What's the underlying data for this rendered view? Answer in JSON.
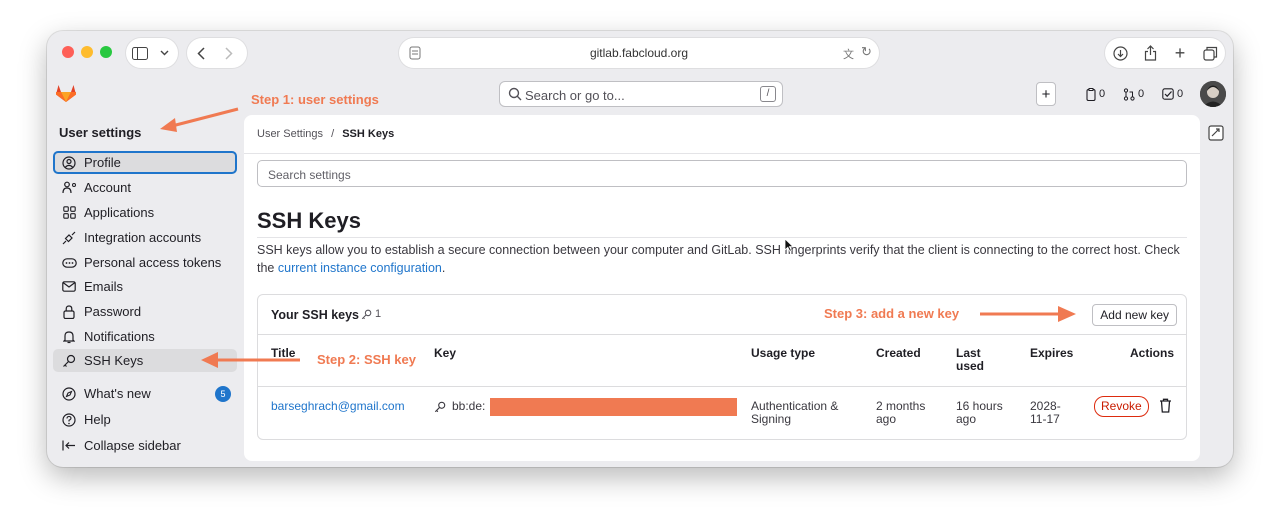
{
  "browser": {
    "url": "gitlab.fabcloud.org"
  },
  "topbar": {
    "search_placeholder": "Search or go to...",
    "search_shortcut": "/",
    "issues_count": "0",
    "mr_count": "0",
    "todo_count": "0"
  },
  "sidebar": {
    "title": "User settings",
    "items": [
      {
        "label": "Profile",
        "icon": "profile-icon"
      },
      {
        "label": "Account",
        "icon": "account-icon"
      },
      {
        "label": "Applications",
        "icon": "applications-icon"
      },
      {
        "label": "Integration accounts",
        "icon": "integration-icon"
      },
      {
        "label": "Personal access tokens",
        "icon": "token-icon"
      },
      {
        "label": "Emails",
        "icon": "mail-icon"
      },
      {
        "label": "Password",
        "icon": "lock-icon"
      },
      {
        "label": "Notifications",
        "icon": "bell-icon"
      },
      {
        "label": "SSH Keys",
        "icon": "key-icon"
      }
    ],
    "bottom": [
      {
        "label": "What's new",
        "icon": "compass-icon",
        "badge": "5"
      },
      {
        "label": "Help",
        "icon": "help-icon"
      },
      {
        "label": "Collapse sidebar",
        "icon": "collapse-icon"
      }
    ]
  },
  "breadcrumb": {
    "parent": "User Settings",
    "separator": "/",
    "current": "SSH Keys"
  },
  "main": {
    "search_placeholder": "Search settings",
    "title": "SSH Keys",
    "description": "SSH keys allow you to establish a secure connection between your computer and GitLab. SSH fingerprints verify that the client is connecting to the correct host. Check the",
    "description_link": "current instance configuration",
    "description_end": "."
  },
  "keys_card": {
    "title": "Your SSH keys",
    "count": "1",
    "add_button": "Add new key",
    "columns": [
      "Title",
      "Key",
      "Usage type",
      "Created",
      "Last used",
      "Expires",
      "Actions"
    ],
    "rows": [
      {
        "title": "barseghrach@gmail.com",
        "key_prefix": "bb:de:",
        "usage_line1": "Authentication &",
        "usage_line2": "Signing",
        "created_line1": "2 months",
        "created_line2": "ago",
        "last_used_line1": "16 hours",
        "last_used_line2": "ago",
        "expires_line1": "2028-",
        "expires_line2": "11-17",
        "revoke": "Revoke"
      }
    ]
  },
  "annotations": {
    "step1": "Step 1: user settings",
    "step2": "Step 2: SSH key",
    "step3": "Step 3: add a new key",
    "color": "#f07a52"
  }
}
